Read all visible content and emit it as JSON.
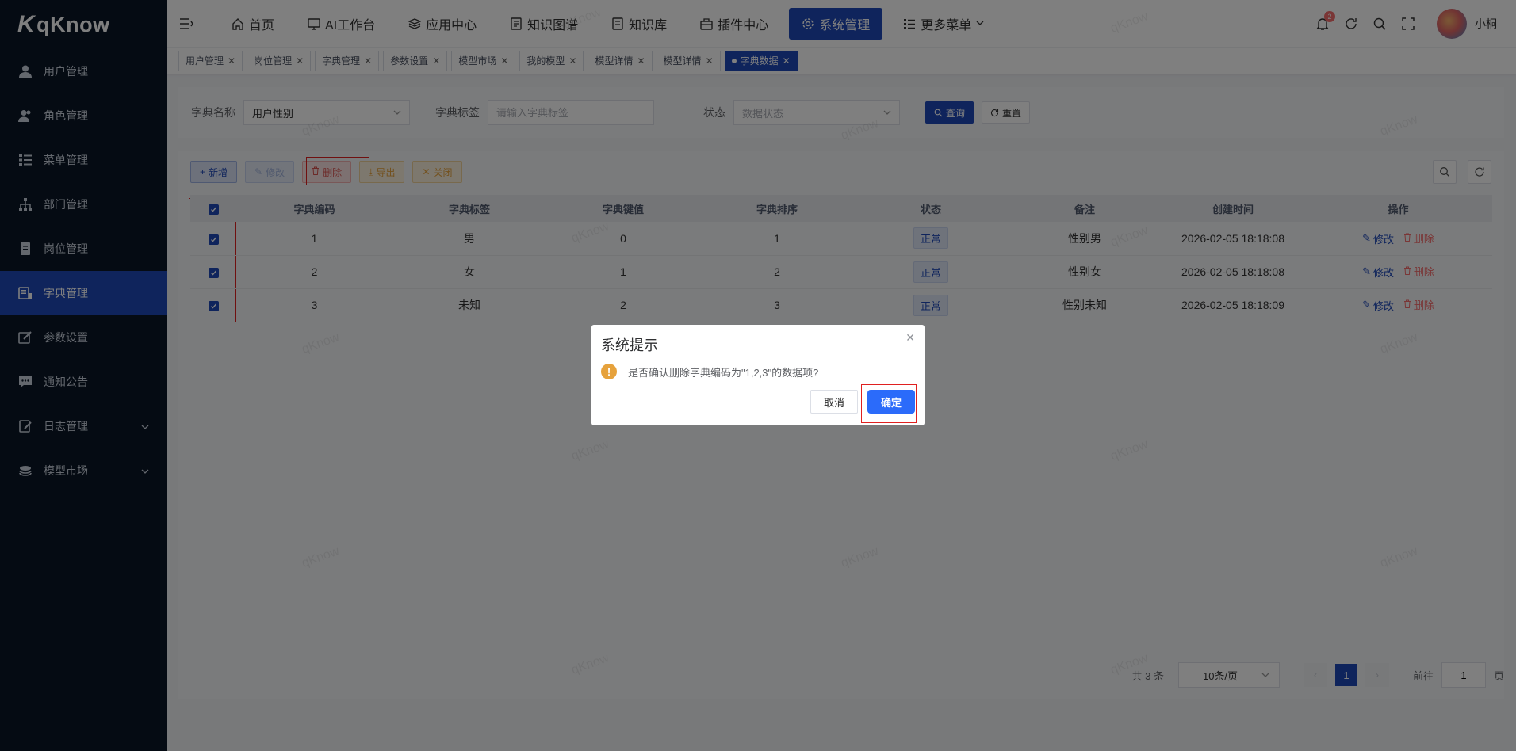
{
  "app": {
    "name": "qKnow",
    "logo_mark": "K"
  },
  "sidebar": {
    "items": [
      {
        "label": "用户管理",
        "icon": "user-icon"
      },
      {
        "label": "角色管理",
        "icon": "users-icon"
      },
      {
        "label": "菜单管理",
        "icon": "list-icon"
      },
      {
        "label": "部门管理",
        "icon": "org-tree-icon"
      },
      {
        "label": "岗位管理",
        "icon": "post-icon"
      },
      {
        "label": "字典管理",
        "icon": "dict-icon",
        "active": true
      },
      {
        "label": "参数设置",
        "icon": "edit-icon"
      },
      {
        "label": "通知公告",
        "icon": "message-icon"
      },
      {
        "label": "日志管理",
        "icon": "log-icon",
        "expandable": true
      },
      {
        "label": "模型市场",
        "icon": "model-icon",
        "expandable": true
      }
    ]
  },
  "topnav": {
    "items": [
      {
        "label": "首页",
        "icon": "home-icon"
      },
      {
        "label": "AI工作台",
        "icon": "monitor-icon"
      },
      {
        "label": "应用中心",
        "icon": "stack-icon"
      },
      {
        "label": "知识图谱",
        "icon": "document-icon"
      },
      {
        "label": "知识库",
        "icon": "book-icon"
      },
      {
        "label": "插件中心",
        "icon": "plugin-icon"
      },
      {
        "label": "系统管理",
        "icon": "gear-icon",
        "active": true
      },
      {
        "label": "更多菜单",
        "icon": "menu-icon"
      }
    ],
    "notification_count": "2",
    "username": "小桐"
  },
  "tabs": [
    "用户管理",
    "岗位管理",
    "字典管理",
    "参数设置",
    "模型市场",
    "我的模型",
    "模型详情",
    "模型详情",
    "字典数据"
  ],
  "search": {
    "dict_name_label": "字典名称",
    "dict_name_value": "用户性别",
    "dict_label_label": "字典标签",
    "dict_label_placeholder": "请输入字典标签",
    "status_label": "状态",
    "status_placeholder": "数据状态",
    "query_btn": "查询",
    "reset_btn": "重置"
  },
  "toolbar": {
    "add": "新增",
    "edit": "修改",
    "delete": "删除",
    "export": "导出",
    "close": "关闭"
  },
  "table": {
    "headers": [
      "字典编码",
      "字典标签",
      "字典键值",
      "字典排序",
      "状态",
      "备注",
      "创建时间",
      "操作"
    ],
    "rows": [
      {
        "code": "1",
        "label": "男",
        "value": "0",
        "sort": "1",
        "status": "正常",
        "remark": "性别男",
        "created": "2026-02-05 18:18:08"
      },
      {
        "code": "2",
        "label": "女",
        "value": "1",
        "sort": "2",
        "status": "正常",
        "remark": "性别女",
        "created": "2026-02-05 18:18:08"
      },
      {
        "code": "3",
        "label": "未知",
        "value": "2",
        "sort": "3",
        "status": "正常",
        "remark": "性别未知",
        "created": "2026-02-05 18:18:09"
      }
    ],
    "op_edit": "修改",
    "op_delete": "删除"
  },
  "pagination": {
    "total_text": "共 3 条",
    "page_size": "10条/页",
    "current_page": "1",
    "goto_prefix": "前往",
    "goto_value": "1",
    "goto_suffix": "页"
  },
  "watermark": "qKnow",
  "dialog": {
    "title": "系统提示",
    "message": "是否确认删除字典编码为\"1,2,3\"的数据项?",
    "cancel": "取消",
    "confirm": "确定"
  },
  "colors": {
    "primary": "#1e48b8",
    "sidebar_bg": "#0b1627",
    "danger": "#f56c6c",
    "warning": "#e6a23c",
    "dialog_confirm": "#2b6bfa"
  }
}
